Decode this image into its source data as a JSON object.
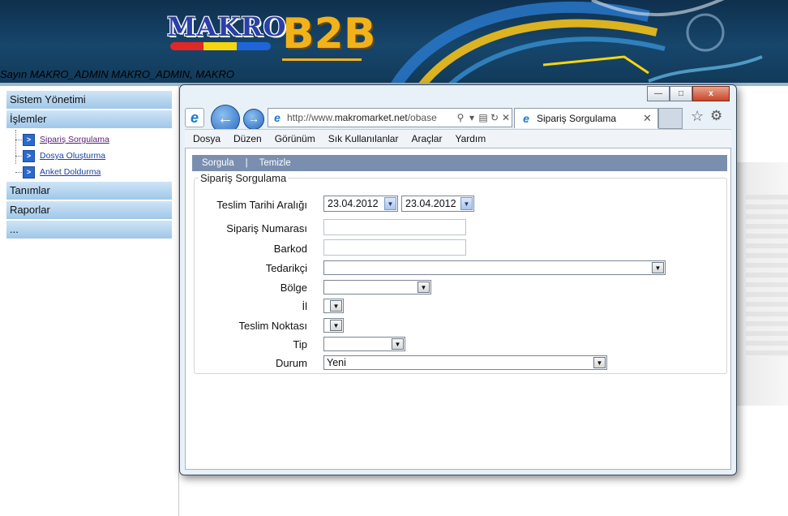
{
  "header": {
    "logo_makro": "MAKRO",
    "logo_b2b": "B2B",
    "welcome": "Sayın MAKRO_ADMIN MAKRO_ADMIN, MAKRO"
  },
  "left_menu": {
    "categories": [
      "Sistem Yönetimi",
      "İşlemler",
      "Tanımlar",
      "Raporlar",
      "..."
    ],
    "sub_items": [
      "Sipariş Sorgulama",
      "Dosya Oluşturma",
      "Anket Doldurma"
    ]
  },
  "browser": {
    "window_buttons": {
      "minimize": "—",
      "maximize": "□",
      "close": "x"
    },
    "address_prefix": "http://www.",
    "address_domain": "makromarket.net",
    "address_suffix": "/obase",
    "tab_title": "Sipariş Sorgulama",
    "menubar": [
      "Dosya",
      "Düzen",
      "Görünüm",
      "Sık Kullanılanlar",
      "Araçlar",
      "Yardım"
    ]
  },
  "form": {
    "toolbar": {
      "query": "Sorgula",
      "separator": "|",
      "clear": "Temizle"
    },
    "title": "Sipariş Sorgulama",
    "labels": {
      "date_range": "Teslim Tarihi Aralığı",
      "order_no": "Sipariş Numarası",
      "barcode": "Barkod",
      "supplier": "Tedarikçi",
      "region": "Bölge",
      "city": "İl",
      "delivery_point": "Teslim Noktası",
      "type": "Tip",
      "status": "Durum"
    },
    "values": {
      "date_from": "23.04.2012",
      "date_to": "23.04.2012",
      "order_no": "",
      "barcode": "",
      "supplier": "",
      "region": "",
      "city": "",
      "delivery_point": "",
      "type": "",
      "status": "Yeni"
    }
  },
  "icons": {
    "back": "arrow-left",
    "forward": "arrow-right",
    "favorites": "star",
    "tools": "gear",
    "dropdown": "chevron-down"
  },
  "colors": {
    "header_bg": "#16466b",
    "menu_category": "#9fc7e9",
    "form_toolbar": "#7a8fb0",
    "link": "#1c3fa5"
  }
}
